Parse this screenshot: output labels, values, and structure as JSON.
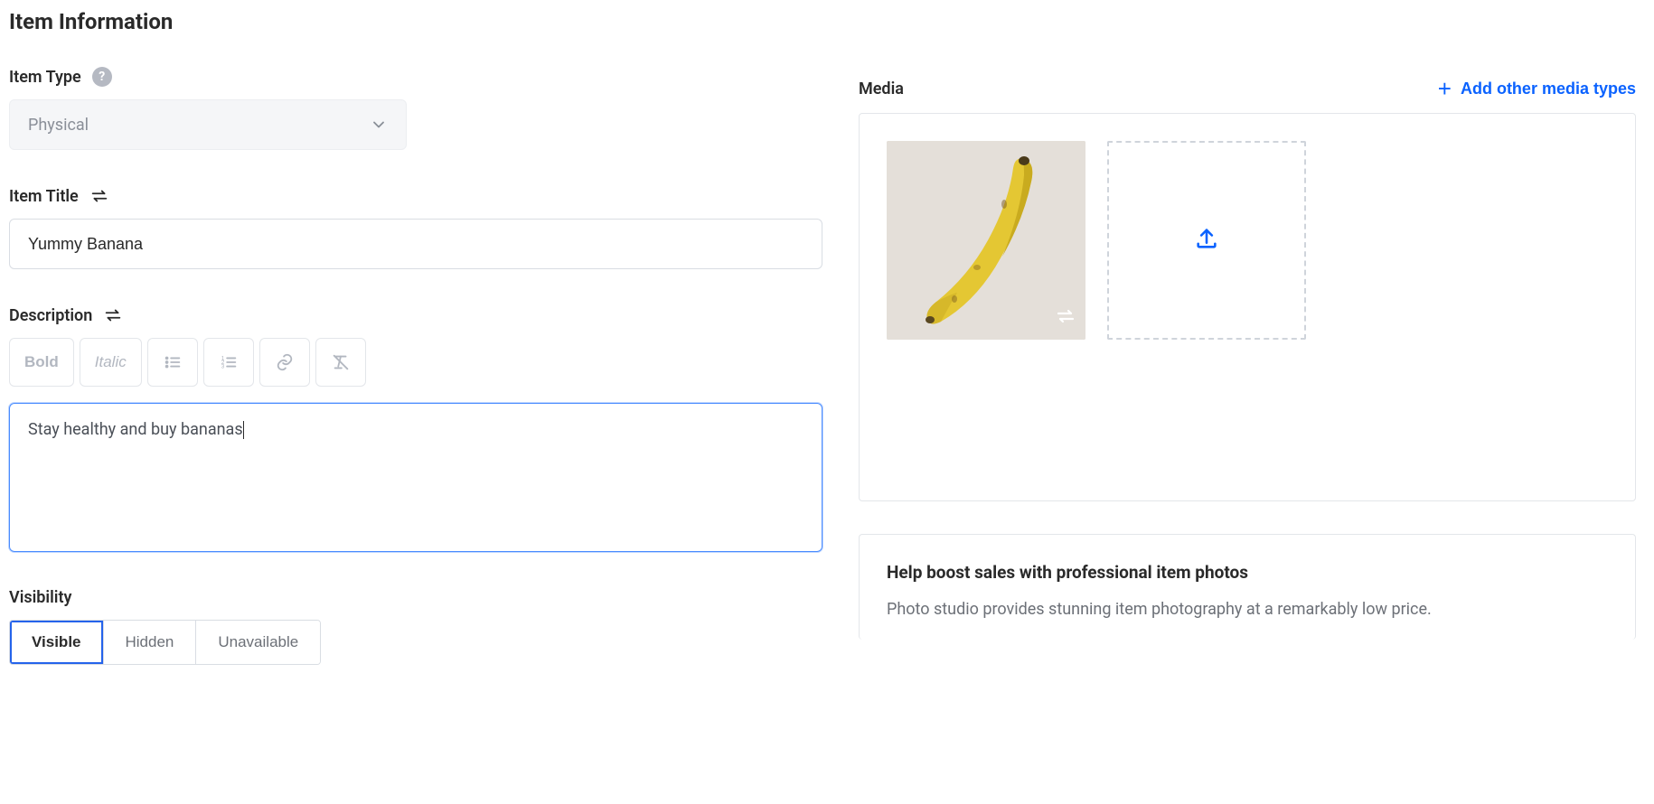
{
  "section_title": "Item Information",
  "item_type": {
    "label": "Item Type",
    "value": "Physical"
  },
  "item_title": {
    "label": "Item Title",
    "value": "Yummy Banana"
  },
  "description": {
    "label": "Description",
    "toolbar": {
      "bold": "Bold",
      "italic": "Italic"
    },
    "value": "Stay healthy and buy bananas"
  },
  "visibility": {
    "label": "Visibility",
    "options": [
      "Visible",
      "Hidden",
      "Unavailable"
    ],
    "selected": "Visible"
  },
  "media": {
    "label": "Media",
    "add_button": "Add other media types"
  },
  "callout": {
    "title": "Help boost sales with professional item photos",
    "body": "Photo studio provides stunning item photography at a remarkably low price."
  }
}
